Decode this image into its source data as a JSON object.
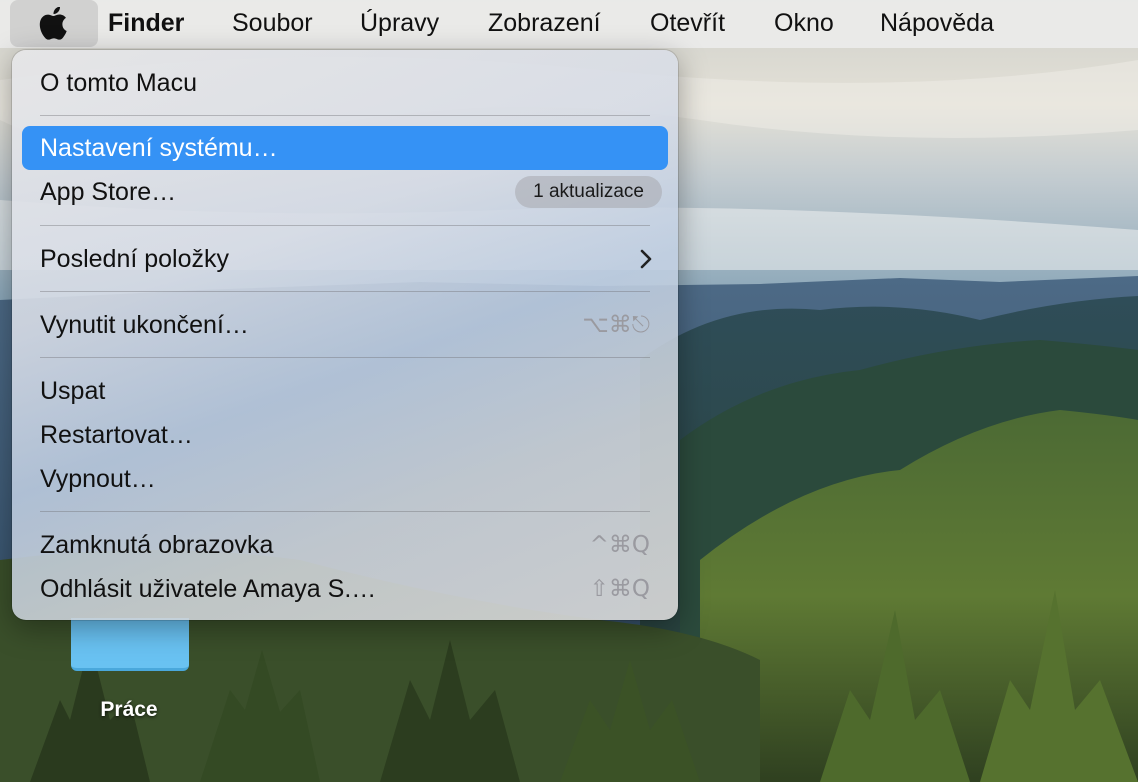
{
  "menubar": {
    "apple_icon": "apple-logo-icon",
    "app_name": "Finder",
    "menus": [
      "Soubor",
      "Úpravy",
      "Zobrazení",
      "Otevřít",
      "Okno",
      "Nápověda"
    ]
  },
  "apple_menu": {
    "items": [
      {
        "label": "O tomto Macu"
      },
      {
        "label": "Nastavení systému…",
        "selected": true
      },
      {
        "label": "App Store…",
        "badge": "1 aktualizace"
      },
      {
        "label": "Poslední položky",
        "submenu_icon": "chevron-right-icon"
      },
      {
        "label": "Vynutit ukončení…",
        "shortcut": "⌥⌘⎋"
      },
      {
        "label": "Uspat"
      },
      {
        "label": "Restartovat…"
      },
      {
        "label": "Vypnout…"
      },
      {
        "label": "Zamknutá obrazovka",
        "shortcut": "^⌘Q"
      },
      {
        "label": "Odhlásit uživatele Amaya S.…",
        "shortcut": "⇧⌘Q"
      }
    ]
  },
  "desktop": {
    "folder_label": "Práce",
    "folder_icon": "folder-icon"
  },
  "colors": {
    "selection": "#3592f5",
    "folder": "#69c2f2"
  }
}
